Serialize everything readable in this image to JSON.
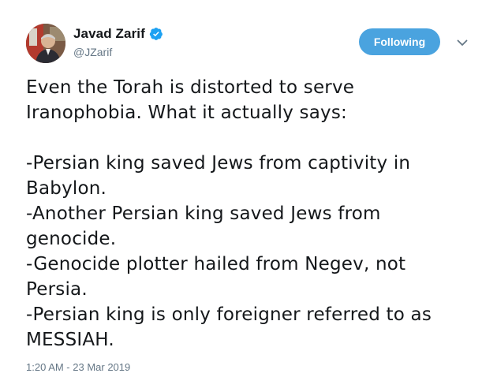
{
  "author": {
    "display_name": "Javad Zarif",
    "handle": "@JZarif",
    "verified_icon": "verified-badge-icon",
    "avatar_icon": "profile-photo"
  },
  "follow_button": {
    "label": "Following"
  },
  "menu_icon": "chevron-down-icon",
  "tweet": {
    "lines": [
      "Even the Torah is distorted to serve",
      "Iranophobia. What it actually says:",
      "",
      "-Persian king saved Jews from captivity in",
      "Babylon.",
      "-Another Persian king saved Jews from",
      "genocide.",
      "-Genocide plotter hailed from Negev, not",
      "Persia.",
      "-Persian king is only foreigner referred to as",
      "MESSIAH."
    ],
    "timestamp": "1:20 AM - 23 Mar 2019"
  },
  "colors": {
    "accent": "#1da1f2",
    "button_bg": "#4aa3df",
    "secondary_text": "#657786",
    "primary_text": "#14171a"
  }
}
